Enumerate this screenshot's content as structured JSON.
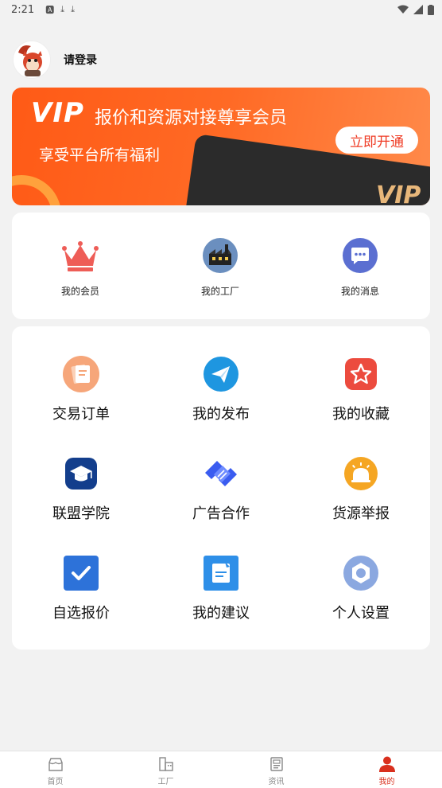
{
  "status_bar": {
    "time": "2:21"
  },
  "profile": {
    "login_text": "请登录"
  },
  "vip_banner": {
    "logo": "VIP",
    "title": "报价和资源对接尊享会员",
    "subtitle": "享受平台所有福利",
    "open_button": "立即开通",
    "watermark": "VIP"
  },
  "top_menu": [
    {
      "label": "我的会员",
      "icon": "crown-icon"
    },
    {
      "label": "我的工厂",
      "icon": "factory-icon"
    },
    {
      "label": "我的消息",
      "icon": "message-icon"
    }
  ],
  "grid_menu": [
    {
      "label": "交易订单",
      "icon": "order-icon"
    },
    {
      "label": "我的发布",
      "icon": "paper-plane-icon"
    },
    {
      "label": "我的收藏",
      "icon": "star-icon"
    },
    {
      "label": "联盟学院",
      "icon": "graduation-cap-icon"
    },
    {
      "label": "广告合作",
      "icon": "handshake-icon"
    },
    {
      "label": "货源举报",
      "icon": "alarm-bell-icon"
    },
    {
      "label": "自选报价",
      "icon": "checkbox-icon"
    },
    {
      "label": "我的建议",
      "icon": "note-edit-icon"
    },
    {
      "label": "个人设置",
      "icon": "settings-icon"
    }
  ],
  "bottom_nav": [
    {
      "label": "首页",
      "icon": "home-store-icon",
      "active": false
    },
    {
      "label": "工厂",
      "icon": "building-icon",
      "active": false
    },
    {
      "label": "资讯",
      "icon": "news-icon",
      "active": false
    },
    {
      "label": "我的",
      "icon": "user-icon",
      "active": true
    }
  ],
  "colors": {
    "accent": "#d9301e",
    "vip_orange": "#ff5a16",
    "background": "#f2f2f2"
  }
}
